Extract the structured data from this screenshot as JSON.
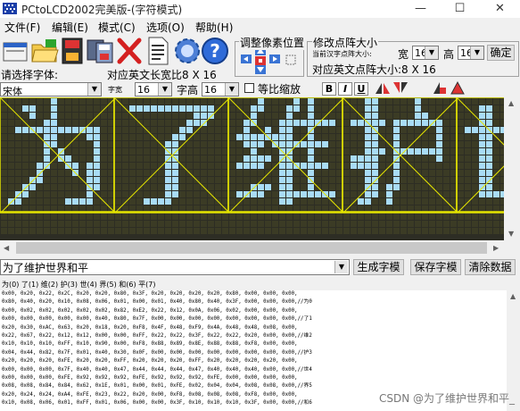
{
  "title_bar": {
    "title": "PCtoLCD2002完美版-(字符模式)",
    "minimize_glyph": "—",
    "maximize_glyph": "☐",
    "close_glyph": "✕"
  },
  "menu": {
    "items": [
      "文件(F)",
      "编辑(E)",
      "模式(C)",
      "选项(O)",
      "帮助(H)"
    ]
  },
  "toolbar": {
    "icons": [
      "new-file-icon",
      "open-folder-icon",
      "save-icon",
      "multi-save-icon",
      "delete-icon",
      "document-icon",
      "settings-gear-icon",
      "help-icon"
    ]
  },
  "pixel_group": {
    "title": "调整像素位置"
  },
  "matrix_group": {
    "title": "修改点阵大小",
    "chinese_size_label": "当前汉字点阵大小:",
    "width_label": "宽",
    "width_value": "16",
    "height_label": "高",
    "height_value": "16",
    "confirm_label": "确定",
    "english_size_label": "对应英文点阵大小:8 X 16"
  },
  "font_section": {
    "select_font_label": "请选择字体:",
    "english_ratio_label": "对应英文长宽比8 X 16",
    "font_value": "宋体",
    "char_width_label": "字宽",
    "char_width_value": "16",
    "char_height_label": "字高",
    "char_height_value": "16",
    "scale_label": "等比缩放",
    "bold_label": "B",
    "italic_label": "I",
    "underline_label": "U"
  },
  "glyph_canvas": {
    "characters": [
      "为",
      "了",
      "维",
      "护",
      "世"
    ],
    "lit_color": "#a9dcf6",
    "unlit_color": "#3b3b25",
    "frame_color": "#e6e600"
  },
  "input_row": {
    "text": "为了维护世界和平",
    "generate_label": "生成字模",
    "save_label": "保存字模",
    "clear_label": "清除数据"
  },
  "char_labels": "为(0) 了(1) 维(2) 护(3) 世(4) 界(5) 和(6) 平(7)",
  "output_lines": [
    "0x00, 0x20, 0x22, 0x2C, 0x20, 0x20, 0x80, 0x3F, 0x20, 0x20, 0x20, 0x20, 0x80, 0x00, 0x00, 0x00,",
    "0x80, 0x40, 0x20, 0x10, 0x08, 0x06, 0x01, 0x00, 0x01, 0x40, 0x80, 0x40, 0x3F, 0x00, 0x00, 0x00,//为0",
    "0x00, 0x02, 0x02, 0x02, 0x02, 0x02, 0x82, 0xE2, 0x22, 0x12, 0x0A, 0x06, 0x02, 0x00, 0x00, 0x00,",
    "0x00, 0x00, 0x00, 0x00, 0x00, 0x40, 0x80, 0x7F, 0x00, 0x00, 0x00, 0x00, 0x00, 0x00, 0x00, 0x00,//了1",
    "0x20, 0x30, 0xAC, 0x63, 0x20, 0x18, 0x20, 0xF8, 0x4F, 0x48, 0xF9, 0x4A, 0x48, 0x48, 0x08, 0x00,",
    "0x22, 0x67, 0x22, 0x12, 0x12, 0x00, 0x00, 0xFF, 0x22, 0x22, 0x3F, 0x22, 0x22, 0x20, 0x00, 0x00,//维2",
    "0x10, 0x10, 0x10, 0xFF, 0x10, 0x90, 0x00, 0xF8, 0x88, 0x89, 0x8E, 0x88, 0x88, 0xF8, 0x00, 0x00,",
    "0x04, 0x44, 0x82, 0x7F, 0x01, 0x40, 0x30, 0x0F, 0x00, 0x00, 0x00, 0x00, 0x00, 0x00, 0x00, 0x00,//护3",
    "0x20, 0x20, 0x20, 0xFE, 0x20, 0x20, 0xFF, 0x20, 0x20, 0x20, 0xFF, 0x20, 0x20, 0x20, 0x20, 0x00,",
    "0x00, 0x00, 0x00, 0x7F, 0x40, 0x40, 0x47, 0x44, 0x44, 0x44, 0x47, 0x40, 0x40, 0x40, 0x00, 0x00,//世4",
    "0x00, 0x00, 0x00, 0xFE, 0x92, 0x92, 0x92, 0xFE, 0x92, 0x92, 0x92, 0xFE, 0x00, 0x00, 0x00, 0x00,",
    "0x08, 0x08, 0x84, 0x84, 0x62, 0x1E, 0x01, 0x00, 0x01, 0xFE, 0x02, 0x04, 0x04, 0x08, 0x08, 0x00,//界5",
    "0x20, 0x24, 0x24, 0xA4, 0xFE, 0x23, 0x22, 0x20, 0x00, 0xF8, 0x08, 0x08, 0x08, 0xF8, 0x00, 0x00,",
    "0x10, 0x08, 0x06, 0x01, 0xFF, 0x01, 0x06, 0x00, 0x00, 0x3F, 0x10, 0x10, 0x10, 0x3F, 0x00, 0x00,//和6"
  ],
  "watermark": "CSDN @为了维护世界和平_"
}
